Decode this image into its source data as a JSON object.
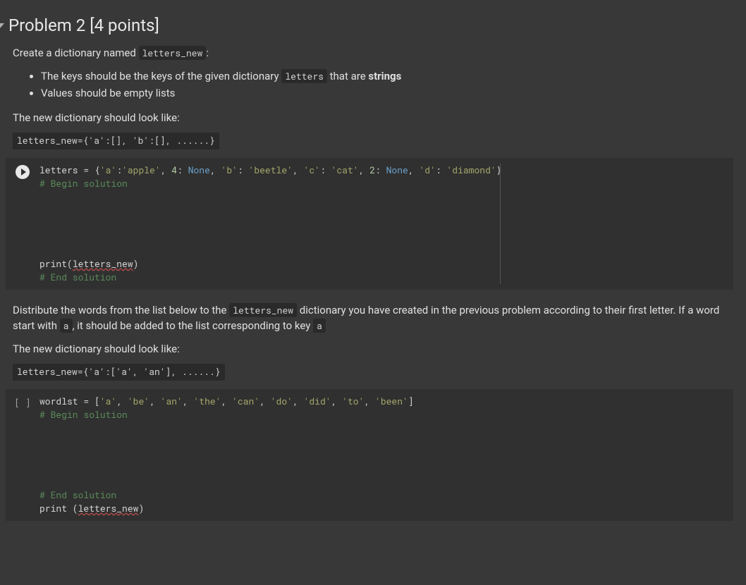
{
  "heading": "Problem 2 [4 points]",
  "p1_pre": "Create a dictionary named ",
  "p1_code": "letters_new",
  "p1_post": ":",
  "bullet1_pre": "The keys should be the keys of the given dictionary ",
  "bullet1_code": "letters",
  "bullet1_mid": " that are ",
  "bullet1_strong": "strings",
  "bullet2": "Values should be empty lists",
  "p2": "The new dictionary should look like:",
  "example1": "letters_new={'a':[], 'b':[], ......}",
  "cell1": {
    "line1": {
      "assign": "letters = {",
      "pairs": [
        {
          "k": "'a'",
          "sep": ":",
          "v": "'apple'"
        },
        {
          "k": "4",
          "sep": ": ",
          "v": "None"
        },
        {
          "k": "'b'",
          "sep": ": ",
          "v": "'beetle'"
        },
        {
          "k": "'c'",
          "sep": ": ",
          "v": "'cat'"
        },
        {
          "k": "2",
          "sep": ": ",
          "v": "None"
        },
        {
          "k": "'d'",
          "sep": ": ",
          "v": "'diamond'"
        }
      ],
      "close": "}"
    },
    "begin": "# Begin solution",
    "print_pre": "print(",
    "print_var": "letters_new",
    "print_post": ")",
    "end": "# End solution"
  },
  "p3_pre": "Distribute the words from the list below to the ",
  "p3_code": "letters_new",
  "p3_mid": " dictionary you have created in the previous problem according to their first letter. If a word start with ",
  "p3_code2": "a",
  "p3_mid2": ", it should be added to the list corresponding to key ",
  "p3_code3": "a",
  "p4": "The new dictionary should look like:",
  "example2": "letters_new={'a':['a', 'an'], ......}",
  "cell2": {
    "bracket": "[ ]",
    "line1": {
      "assign": "wordlst = [",
      "items": [
        "'a'",
        "'be'",
        "'an'",
        "'the'",
        "'can'",
        "'do'",
        "'did'",
        "'to'",
        "'been'"
      ],
      "close": "]"
    },
    "begin": "# Begin solution",
    "end": "# End solution",
    "print_pre": "print (",
    "print_var": "letters_new",
    "print_post": ")"
  }
}
